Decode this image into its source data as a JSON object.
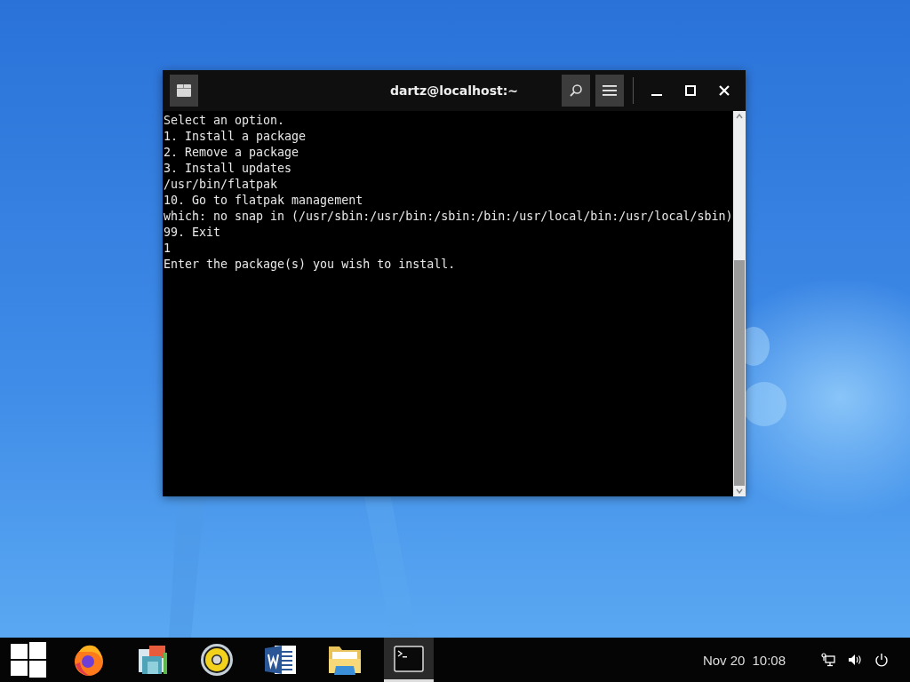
{
  "window": {
    "title": "dartz@localhost:~"
  },
  "terminal": {
    "lines": [
      "Select an option.",
      "1. Install a package",
      "2. Remove a package",
      "3. Install updates",
      "/usr/bin/flatpak",
      "10. Go to flatpak management",
      "which: no snap in (/usr/sbin:/usr/bin:/sbin:/bin:/usr/local/bin:/usr/local/sbin)",
      "99. Exit",
      "1",
      "Enter the package(s) you wish to install."
    ]
  },
  "taskbar": {
    "apps": [
      {
        "kind": "start",
        "selected": false
      },
      {
        "kind": "browser",
        "selected": false
      },
      {
        "kind": "mail",
        "selected": false
      },
      {
        "kind": "speaker",
        "selected": false
      },
      {
        "kind": "word",
        "selected": false
      },
      {
        "kind": "folder",
        "selected": false
      },
      {
        "kind": "terminal",
        "selected": true
      }
    ],
    "date": "Nov 20",
    "time": "10:08"
  }
}
